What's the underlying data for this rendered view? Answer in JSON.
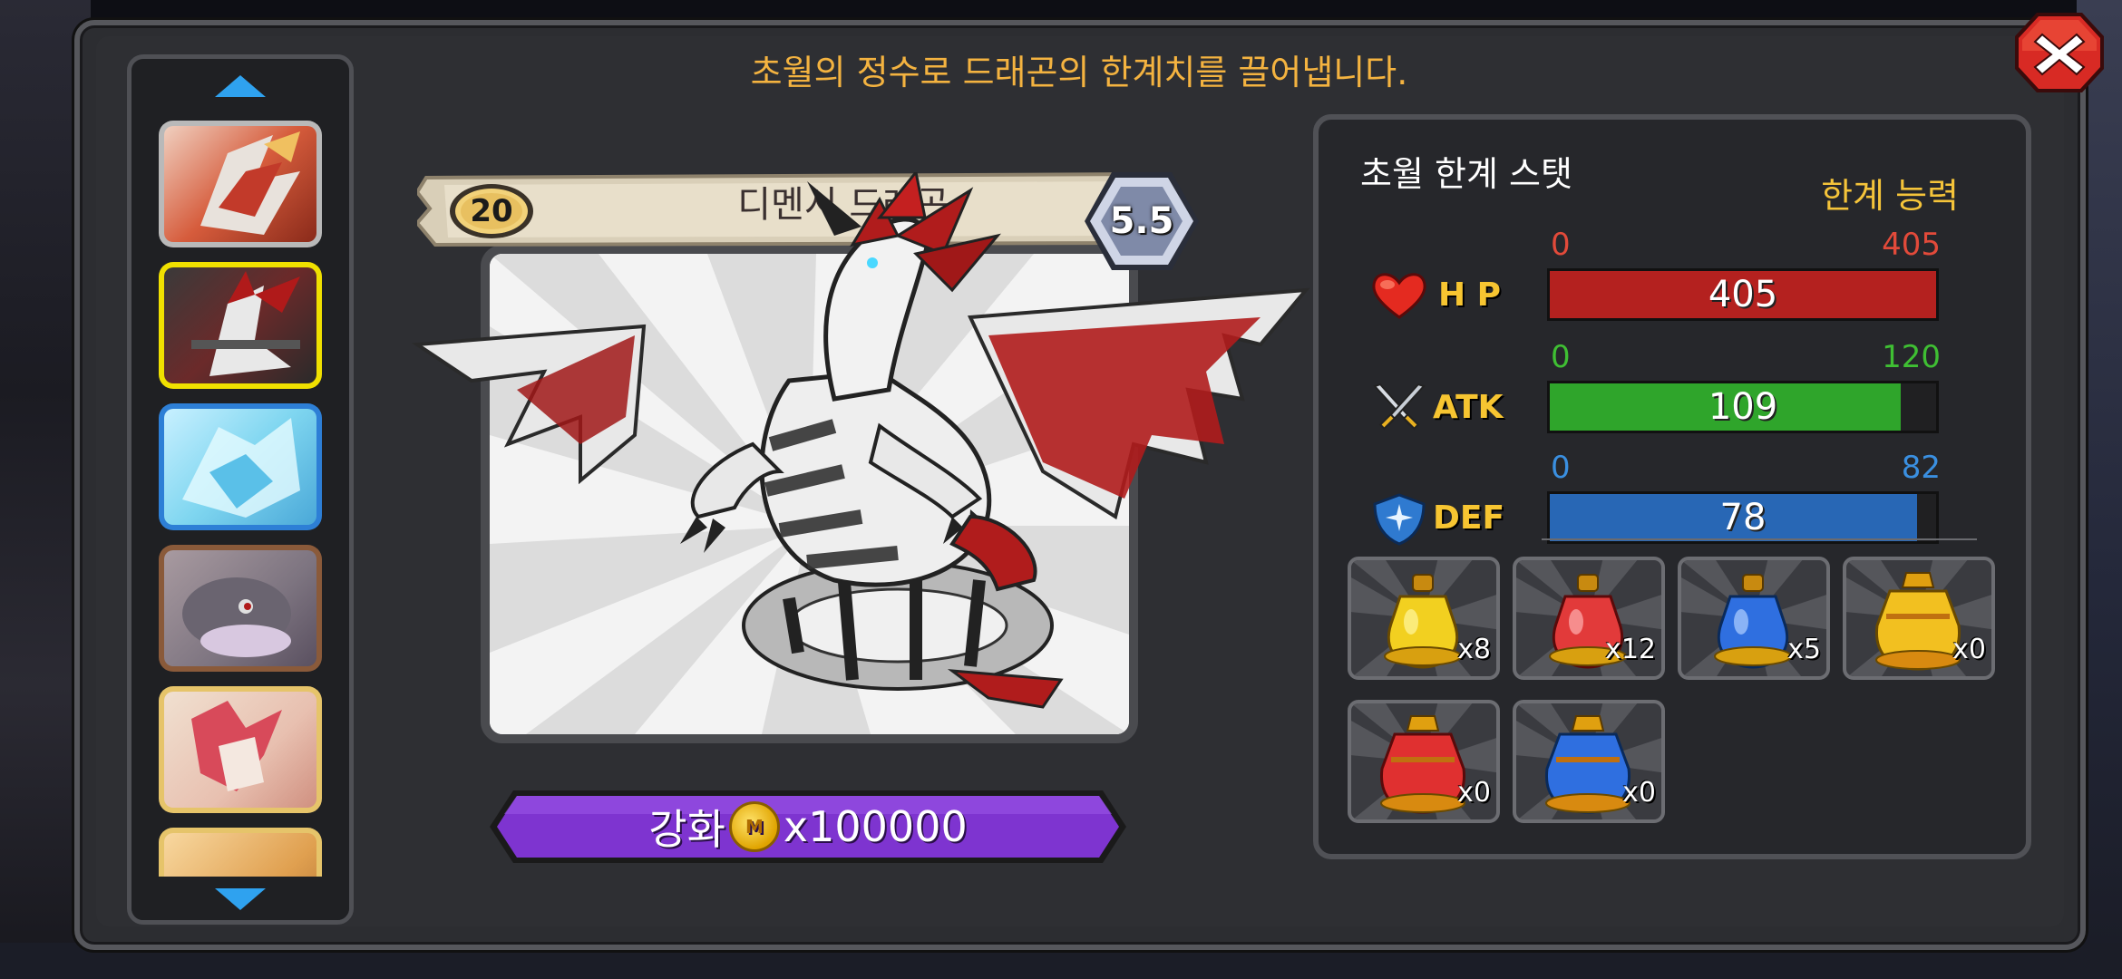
{
  "header": {
    "headline": "초월의 정수로 드래곤의 한계치를 끌어냅니다."
  },
  "card": {
    "level": "20",
    "name": "디멘시 드래곤",
    "grade": "5.5"
  },
  "enhance": {
    "label": "강화",
    "coin_letter": "M",
    "cost": "x100000"
  },
  "stats": {
    "title": "초월 한계 스탯",
    "limit_label": "한계 능력",
    "hp": {
      "name": "H P",
      "min": "0",
      "max": "405",
      "value": "405",
      "fraction": 1.0,
      "color": "#b4211f",
      "range_color": "#e24a3a"
    },
    "atk": {
      "name": "ATK",
      "min": "0",
      "max": "120",
      "value": "109",
      "fraction": 0.9083,
      "color": "#2fa52b",
      "range_color": "#3fbf33"
    },
    "def": {
      "name": "DEF",
      "min": "0",
      "max": "82",
      "value": "78",
      "fraction": 0.9512,
      "color": "#2867b5",
      "range_color": "#3a8fe0"
    }
  },
  "items": [
    {
      "count": "x8",
      "icon": "yellow-potion-icon"
    },
    {
      "count": "x12",
      "icon": "red-potion-icon"
    },
    {
      "count": "x5",
      "icon": "blue-potion-icon"
    },
    {
      "count": "x0",
      "icon": "large-yellow-potion-icon"
    },
    {
      "count": "x0",
      "icon": "large-red-potion-icon"
    },
    {
      "count": "x0",
      "icon": "large-blue-potion-icon"
    }
  ],
  "dragon_list": [
    {
      "name": "fire-dragon-thumb",
      "frame": "#b9b9b9",
      "bg": "#d65c3c"
    },
    {
      "name": "dementia-dragon-thumb",
      "frame": "#f0e000",
      "bg": "#6b2a2a",
      "selected": true
    },
    {
      "name": "ice-dragon-thumb",
      "frame": "#2d7fd6",
      "bg": "#7fd6f0"
    },
    {
      "name": "gray-dragon-thumb",
      "frame": "#8a5a3a",
      "bg": "#7d7480"
    },
    {
      "name": "pink-dragon-thumb",
      "frame": "#e6c46a",
      "bg": "#e8c0b0"
    },
    {
      "name": "gold-dragon-thumb",
      "frame": "#e6c46a",
      "bg": "#e0a050"
    }
  ],
  "colors": {
    "headline": "#f4b340",
    "enhance_button": "#6a1fb8"
  }
}
